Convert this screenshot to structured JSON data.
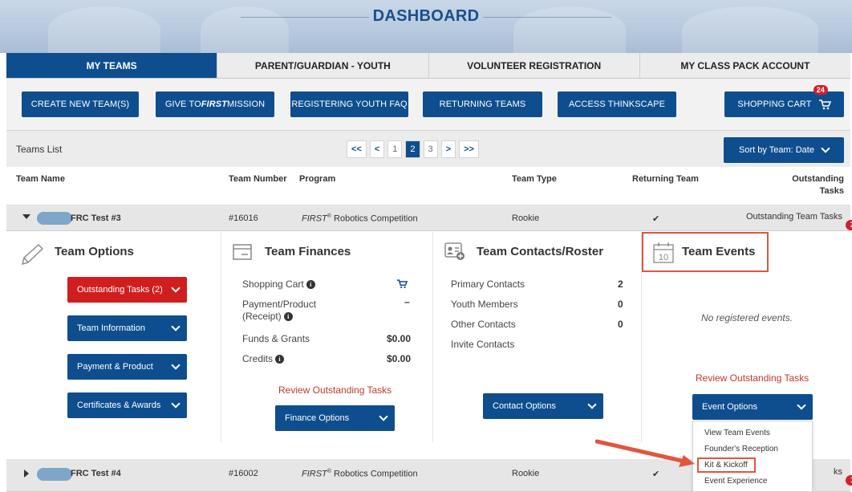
{
  "banner": {
    "title": "DASHBOARD"
  },
  "tabs": [
    {
      "label": "MY TEAMS",
      "active": true
    },
    {
      "label": "PARENT/GUARDIAN - YOUTH",
      "active": false
    },
    {
      "label": "VOLUNTEER REGISTRATION",
      "active": false
    },
    {
      "label": "MY CLASS PACK ACCOUNT",
      "active": false
    }
  ],
  "actions": {
    "create": "CREATE NEW TEAM(S)",
    "give_prefix": "GIVE TO ",
    "give_first": "FIRST",
    "give_suffix": " MISSION",
    "faq": "REGISTERING YOUTH FAQ",
    "returning": "RETURNING TEAMS",
    "thinkscape": "ACCESS THINKSCAPE",
    "cart": "SHOPPING CART",
    "cart_count": "24"
  },
  "list": {
    "label": "Teams List",
    "pager": {
      "first": "<<",
      "prev": "<",
      "pages": [
        "1",
        "2",
        "3"
      ],
      "current": "2",
      "next": ">",
      "last": ">>"
    },
    "sort": "Sort by Team: Date"
  },
  "columns": {
    "name": "Team Name",
    "number": "Team Number",
    "program": "Program",
    "type": "Team Type",
    "returning": "Returning Team",
    "tasks_1": "Outstanding",
    "tasks_2": "Tasks"
  },
  "teams": [
    {
      "name": "FRC Test #3",
      "number": "#16016",
      "program_first": "FIRST",
      "program_reg": "®",
      "program_rest": " Robotics Competition",
      "type": "Rookie",
      "returning": "✔",
      "tasks_label": "Outstanding Team Tasks",
      "tasks_count": "2"
    },
    {
      "name": "FRC Test #4",
      "number": "#16002",
      "program_first": "FIRST",
      "program_reg": "®",
      "program_rest": " Robotics Competition",
      "type": "Rookie",
      "returning": "✔",
      "tasks_label": "ks",
      "tasks_count": "1"
    }
  ],
  "options": {
    "title": "Team Options",
    "outstanding": "Outstanding Tasks (2)",
    "info": "Team Information",
    "payment": "Payment & Product",
    "certs": "Certificates & Awards"
  },
  "finances": {
    "title": "Team Finances",
    "cart": "Shopping Cart",
    "payment_1": "Payment/Product",
    "payment_2": "(Receipt)",
    "payment_value": "–",
    "funds": "Funds & Grants",
    "funds_value": "$0.00",
    "credits": "Credits",
    "credits_value": "$0.00",
    "review": "Review Outstanding Tasks",
    "button": "Finance Options"
  },
  "contacts": {
    "title": "Team Contacts/Roster",
    "primary": "Primary Contacts",
    "primary_value": "2",
    "youth": "Youth Members",
    "youth_value": "0",
    "other": "Other Contacts",
    "other_value": "0",
    "invite": "Invite Contacts",
    "button": "Contact Options"
  },
  "events": {
    "title": "Team Events",
    "calendar_day": "10",
    "none": "No registered events.",
    "review": "Review Outstanding Tasks",
    "button": "Event Options",
    "menu": [
      "View Team Events",
      "Founder's Reception",
      "Kit & Kickoff",
      "Event Experience"
    ]
  },
  "colors": {
    "primary": "#0e4e8e",
    "danger": "#d01e1e",
    "highlight": "#e0563f",
    "info_i": "i"
  }
}
